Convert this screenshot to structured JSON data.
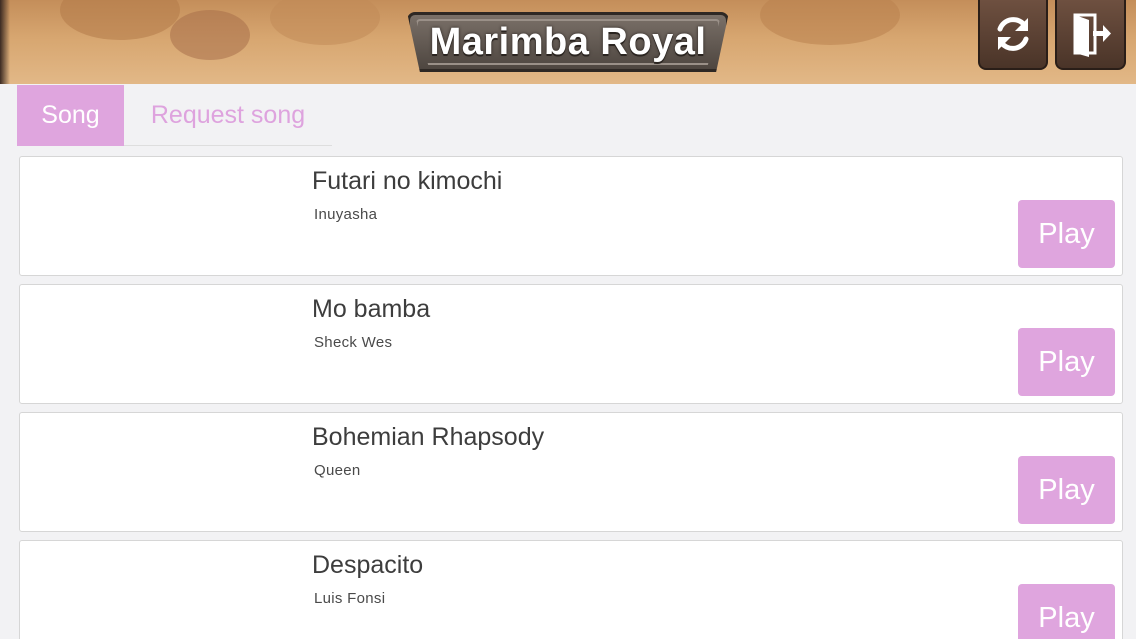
{
  "header": {
    "title": "Marimba Royal",
    "refresh_icon": "refresh-icon",
    "exit_icon": "exit-door-icon"
  },
  "tabs": [
    {
      "label": "Song",
      "active": true
    },
    {
      "label": "Request song",
      "active": false
    }
  ],
  "songs": [
    {
      "title": "Futari no kimochi",
      "artist": "Inuyasha",
      "play_label": "Play"
    },
    {
      "title": "Mo bamba",
      "artist": "Sheck Wes",
      "play_label": "Play"
    },
    {
      "title": "Bohemian Rhapsody",
      "artist": "Queen",
      "play_label": "Play"
    },
    {
      "title": "Despacito",
      "artist": "Luis Fonsi",
      "play_label": "Play"
    }
  ],
  "colors": {
    "accent": "#dfa5de",
    "header_wood": "#d7a670",
    "plate": "#5a524c"
  }
}
